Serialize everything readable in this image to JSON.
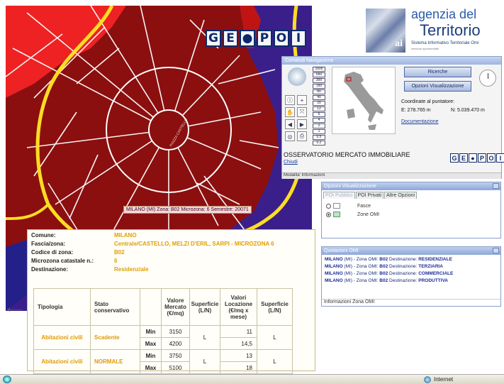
{
  "map": {
    "tooltip": "MILANO (MI) Zona: B02 Microzona: 6 Semestre: 20071",
    "geopoi_letters": [
      "G",
      "E",
      "●",
      "P",
      "O",
      "I"
    ]
  },
  "logo": {
    "line1": "agenzia del",
    "line2": "Territorio",
    "line3": "Sistema Informativo Territoriale Omi",
    "line4": "versione sperimentale"
  },
  "nav_panel": {
    "title": "Comandi Navigazione",
    "scale_values": [
      "1600",
      "650",
      "300",
      "150",
      "80",
      "40",
      "20",
      "12",
      "6",
      "4",
      "2",
      "1",
      "0.5",
      "0.2"
    ],
    "ricerche_label": "Ricerche",
    "opzioni_label": "Opzioni Visualizzazione",
    "coord_label": "Coordinate al puntatore:",
    "coord_e": "E: 278.765 m",
    "coord_n": "N: 5.039.470 m",
    "doc_link": "Documentazione",
    "osservatorio": "OSSERVATORIO MERCATO IMMOBILIARE",
    "chiudi": "Chiudi",
    "footer_tabs": "Modalita' Informazioni"
  },
  "opzioni_panel": {
    "title": "Opzioni Visualizzazione",
    "tabs": [
      "POI Pubblici",
      "POI Privati",
      "Altre Opzioni"
    ],
    "rows": [
      {
        "label": "Fasce"
      },
      {
        "label": "Zone OMI"
      }
    ]
  },
  "quotazioni_panel": {
    "title": "Quotazioni OMI",
    "items": [
      {
        "prefix": "MILANO",
        "mid": " (MI) - Zona OMI: ",
        "zona": "B02",
        "dest_label": " Destinazione: ",
        "dest": "RESIDENZIALE"
      },
      {
        "prefix": "MILANO",
        "mid": " (MI) - Zona OMI: ",
        "zona": "B02",
        "dest_label": " Destinazione: ",
        "dest": "TERZIARIA"
      },
      {
        "prefix": "MILANO",
        "mid": " (MI) - Zona OMI: ",
        "zona": "B02",
        "dest_label": " Destinazione: ",
        "dest": "COMMERCIALE"
      },
      {
        "prefix": "MILANO",
        "mid": " (MI) - Zona OMI: ",
        "zona": "B02",
        "dest_label": " Destinazione: ",
        "dest": "PRODUTTIVA"
      }
    ],
    "footer": "Informazioni Zona OMI"
  },
  "info": {
    "fields": [
      {
        "key": "Comune:",
        "value": "MILANO"
      },
      {
        "key": "Fascia/zona:",
        "value": "Centrale/CASTELLO, MELZI D'ERIL, SARPI - MICROZONA 6"
      },
      {
        "key": "Codice di zona:",
        "value": "B02"
      },
      {
        "key": "Microzona catastale n.:",
        "value": "6"
      },
      {
        "key": "Destinazione:",
        "value": "Residenziale"
      }
    ],
    "headers": {
      "tipologia": "Tipologia",
      "stato": "Stato conservativo",
      "valore": "Valore Mercato (€/mq)",
      "superficie1": "Superficie (L/N)",
      "locazione": "Valori Locazione (€/mq x mese)",
      "superficie2": "Superficie (L/N)"
    },
    "rows": [
      {
        "tipologia": "Abitazioni civili",
        "stato": "Scadente",
        "min_label": "Min",
        "max_label": "Max",
        "val_min": "3150",
        "val_max": "4200",
        "sup1": "L",
        "loc_min": "11",
        "loc_max": "14,5",
        "sup2": "L"
      },
      {
        "tipologia": "Abitazioni civili",
        "stato": "NORMALE",
        "min_label": "Min",
        "max_label": "Max",
        "val_min": "3750",
        "val_max": "5100",
        "sup1": "L",
        "loc_min": "13",
        "loc_max": "18",
        "sup2": "L"
      }
    ]
  },
  "statusbar": {
    "zone": "Internet"
  }
}
